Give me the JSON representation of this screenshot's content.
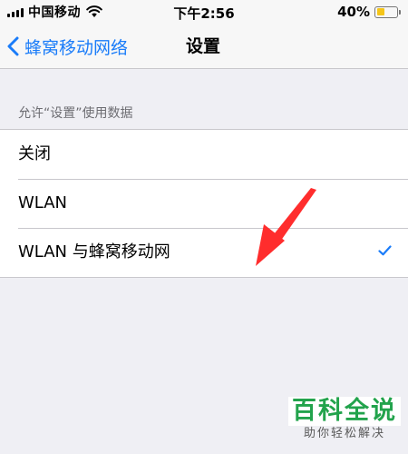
{
  "status_bar": {
    "carrier": "中国移动",
    "time": "下午2:56",
    "battery_percent": "40%",
    "battery_level": 0.4,
    "battery_color": "#f5c518",
    "signal_icon": "signal-bars-icon",
    "wifi_icon": "wifi-icon"
  },
  "nav": {
    "back_label": "蜂窝移动网络",
    "back_icon": "chevron-left-icon",
    "title": "设置"
  },
  "section": {
    "header": "允许“设置”使用数据",
    "options": [
      {
        "label": "关闭",
        "selected": false
      },
      {
        "label": "WLAN",
        "selected": false
      },
      {
        "label": "WLAN 与蜂窝移动网",
        "selected": true
      }
    ]
  },
  "colors": {
    "accent": "#1a7cf9",
    "annotation_arrow": "#ff2d2d",
    "watermark": "#22a34c"
  },
  "watermark": {
    "title": "百科全说",
    "subtitle": "助你轻松解决"
  }
}
